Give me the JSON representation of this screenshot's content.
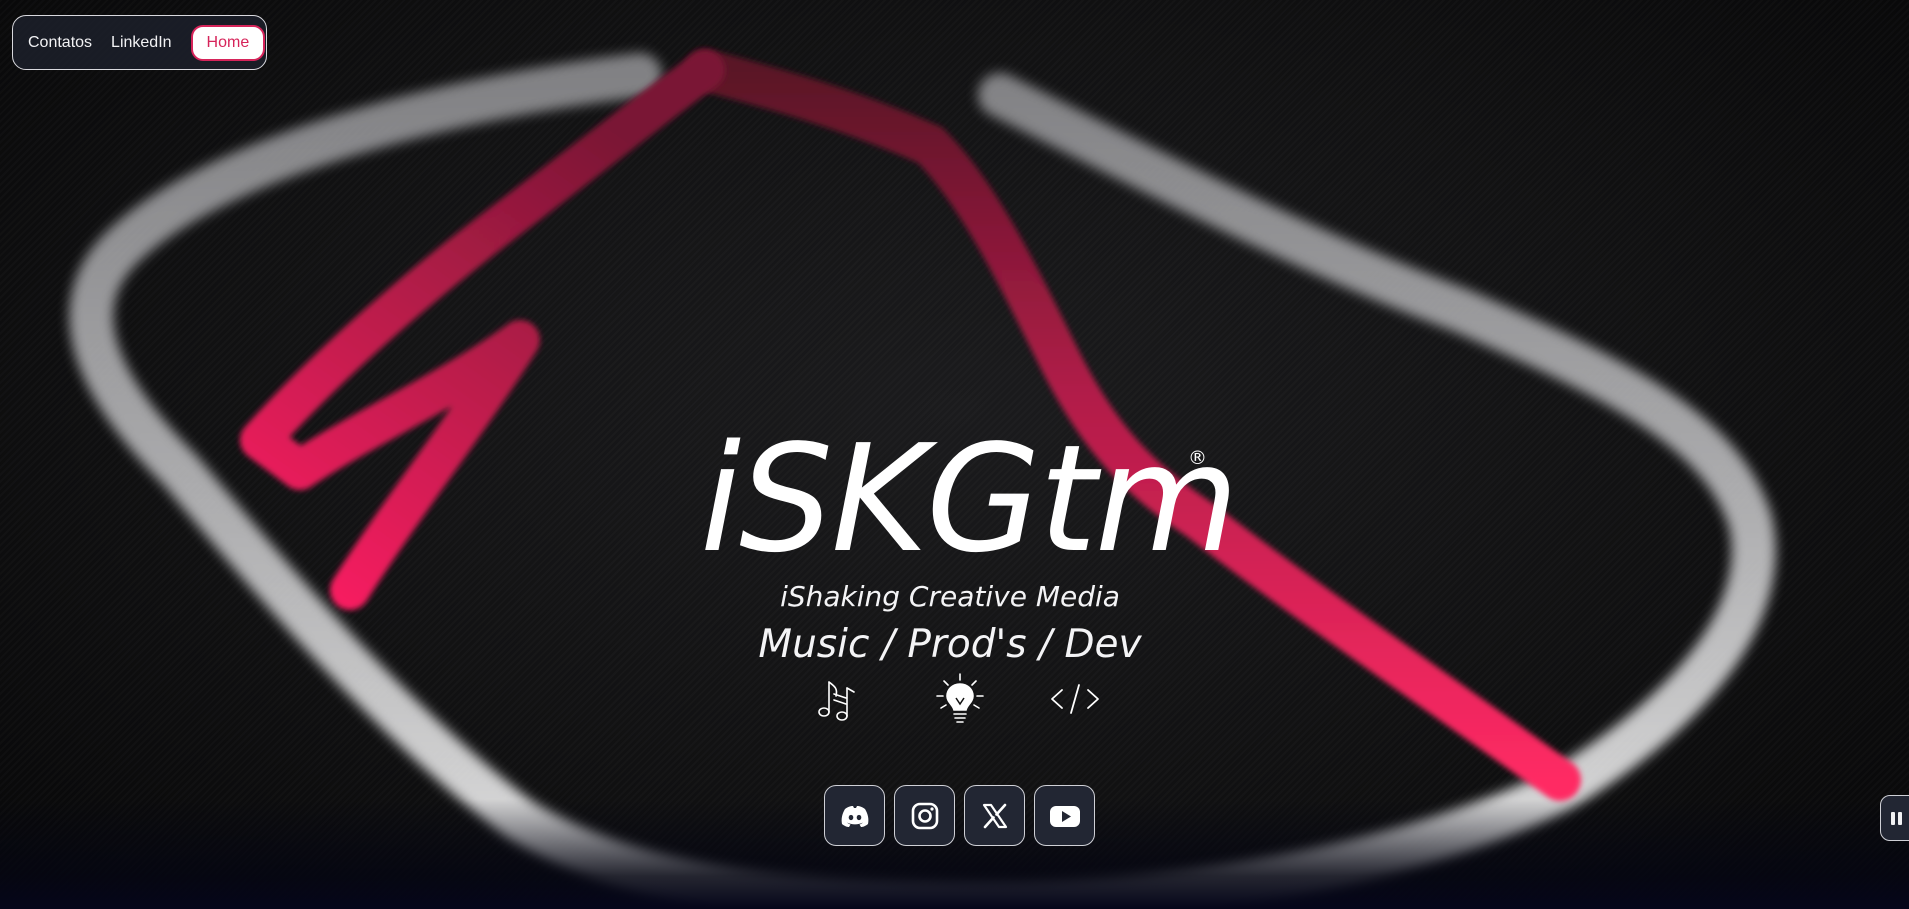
{
  "nav": {
    "contacts_label": "Contatos",
    "linkedin_label": "LinkedIn",
    "home_label": "Home"
  },
  "hero": {
    "brand": "iSKGtm",
    "registered_mark": "®",
    "tagline": "iShaking Creative Media",
    "roles": "Music / Prod's / Dev",
    "role_icons": [
      "music-notes-icon",
      "lightbulb-icon",
      "code-icon"
    ]
  },
  "social": [
    {
      "name": "discord-icon"
    },
    {
      "name": "instagram-icon"
    },
    {
      "name": "x-icon"
    },
    {
      "name": "youtube-icon"
    }
  ],
  "media": {
    "pause_icon": "pause-icon"
  },
  "colors": {
    "accent": "#d6245a",
    "background": "#0b0b0c",
    "button_bg": "#222633",
    "stripe": "#ff2a64"
  }
}
